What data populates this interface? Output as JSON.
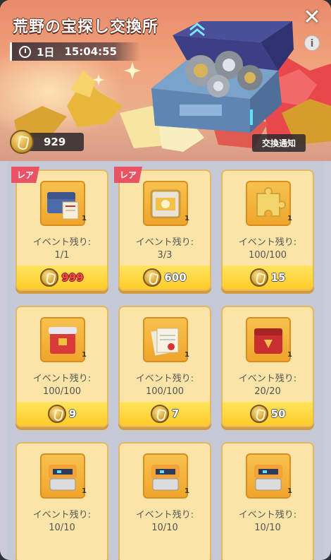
{
  "header": {
    "title": "荒野の宝探し交換所",
    "timer_days": "1日",
    "timer_time": "15:04:55",
    "close_icon": "close-icon",
    "info_label": "i"
  },
  "currency": {
    "amount": "929",
    "icon": "medal-coin-icon"
  },
  "notice_button": "交換通知",
  "colors": {
    "banner": "#f0a37c",
    "card": "#fbe4a8",
    "price_bar": "#ffcb2a",
    "rare_tag": "#ea5364",
    "price_red": "#ff4a4a"
  },
  "items": [
    {
      "rare": "レア",
      "icon": "treasure-chest-scroll-icon",
      "qty": "1",
      "remaining_label": "イベント残り:",
      "remaining": "1/1",
      "price": "999",
      "price_color": "red"
    },
    {
      "rare": "レア",
      "icon": "gold-supply-box-icon",
      "qty": "1",
      "remaining_label": "イベント残り:",
      "remaining": "3/3",
      "price": "600",
      "price_color": "white"
    },
    {
      "rare": "",
      "icon": "puzzle-piece-icon",
      "qty": "1",
      "remaining_label": "イベント残り:",
      "remaining": "100/100",
      "price": "15",
      "price_color": "white"
    },
    {
      "rare": "",
      "icon": "red-crate-icon",
      "qty": "1",
      "remaining_label": "イベント残り:",
      "remaining": "100/100",
      "price": "9",
      "price_color": "white"
    },
    {
      "rare": "",
      "icon": "blueprint-papers-icon",
      "qty": "1",
      "remaining_label": "イベント残り:",
      "remaining": "100/100",
      "price": "7",
      "price_color": "white"
    },
    {
      "rare": "",
      "icon": "red-armor-case-icon",
      "qty": "1",
      "remaining_label": "イベント残り:",
      "remaining": "20/20",
      "price": "50",
      "price_color": "white"
    },
    {
      "rare": "",
      "icon": "robot-supply-box-icon",
      "qty": "1",
      "remaining_label": "イベント残り:",
      "remaining": "10/10",
      "price": "",
      "price_color": "white"
    },
    {
      "rare": "",
      "icon": "robot-supply-box-icon",
      "qty": "1",
      "remaining_label": "イベント残り:",
      "remaining": "10/10",
      "price": "",
      "price_color": "white"
    },
    {
      "rare": "",
      "icon": "robot-supply-box-icon",
      "qty": "1",
      "remaining_label": "イベント残り:",
      "remaining": "10/10",
      "price": "",
      "price_color": "white"
    }
  ]
}
